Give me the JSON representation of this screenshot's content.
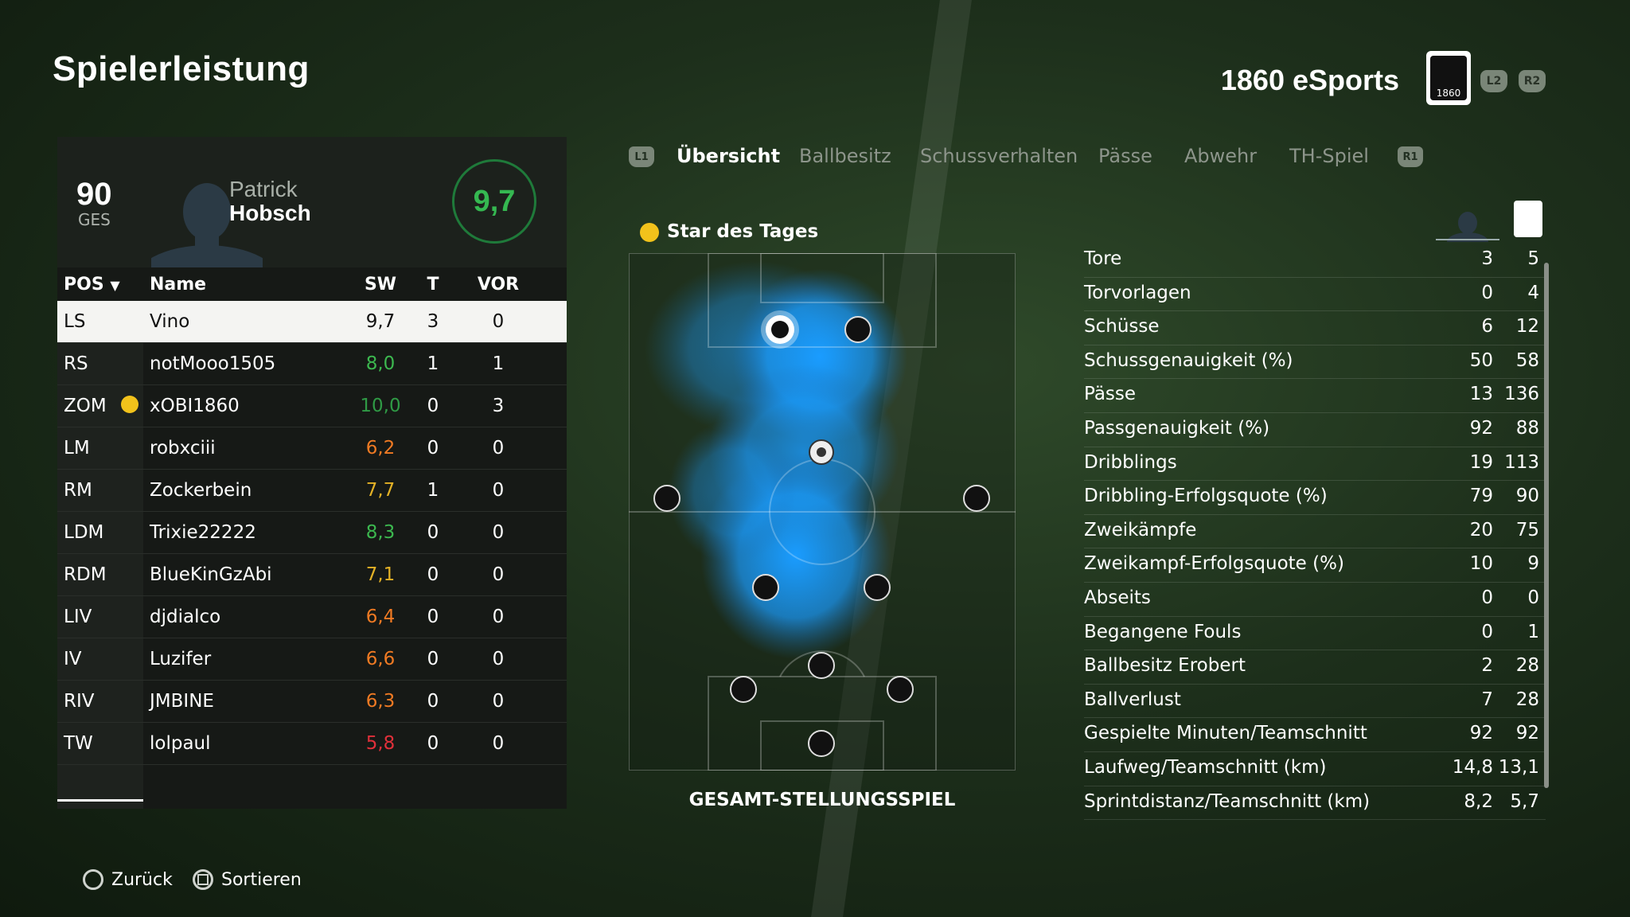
{
  "header": {
    "title": "Spielerleistung",
    "team_name": "1860 eSports",
    "crest_text": "1860",
    "l2": "L2",
    "r2": "R2"
  },
  "player_card": {
    "overall": "90",
    "overall_label": "GES",
    "first_name": "Patrick",
    "last_name": "Hobsch",
    "rating": "9,7"
  },
  "table": {
    "headers": {
      "pos": "POS",
      "name": "Name",
      "sw": "SW",
      "t": "T",
      "vor": "VOR"
    },
    "rows": [
      {
        "pos": "LS",
        "name": "Vino",
        "sw": "9,7",
        "t": "3",
        "vor": "0",
        "color": "#111111"
      },
      {
        "pos": "RS",
        "name": "notMooo1505",
        "sw": "8,0",
        "t": "1",
        "vor": "1",
        "color": "#3cb84f"
      },
      {
        "pos": "ZOM",
        "name": "xOBI1860",
        "sw": "10,0",
        "t": "0",
        "vor": "3",
        "color": "#2f9a45"
      },
      {
        "pos": "LM",
        "name": "robxciii",
        "sw": "6,2",
        "t": "0",
        "vor": "0",
        "color": "#f07a23"
      },
      {
        "pos": "RM",
        "name": "Zockerbein",
        "sw": "7,7",
        "t": "1",
        "vor": "0",
        "color": "#e3b126"
      },
      {
        "pos": "LDM",
        "name": "Trixie22222",
        "sw": "8,3",
        "t": "0",
        "vor": "0",
        "color": "#3cb84f"
      },
      {
        "pos": "RDM",
        "name": "BlueKinGzAbi",
        "sw": "7,1",
        "t": "0",
        "vor": "0",
        "color": "#e3b126"
      },
      {
        "pos": "LIV",
        "name": "djdialco",
        "sw": "6,4",
        "t": "0",
        "vor": "0",
        "color": "#f07a23"
      },
      {
        "pos": "IV",
        "name": "Luzifer",
        "sw": "6,6",
        "t": "0",
        "vor": "0",
        "color": "#f07a23"
      },
      {
        "pos": "RIV",
        "name": "JMBINE",
        "sw": "6,3",
        "t": "0",
        "vor": "0",
        "color": "#f07a23"
      },
      {
        "pos": "TW",
        "name": "lolpaul",
        "sw": "5,8",
        "t": "0",
        "vor": "0",
        "color": "#e0303a"
      }
    ]
  },
  "tabs": {
    "l1": "L1",
    "r1": "R1",
    "items": [
      "Übersicht",
      "Ballbesitz",
      "Schussverhalten",
      "Pässe",
      "Abwehr",
      "TH-Spiel"
    ],
    "active": "Übersicht"
  },
  "star_of_day": "Star des Tages",
  "pitch_caption": "GESAMT-STELLUNGSSPIEL",
  "stats": [
    {
      "label": "Tore",
      "player": "3",
      "team": "5"
    },
    {
      "label": "Torvorlagen",
      "player": "0",
      "team": "4"
    },
    {
      "label": "Schüsse",
      "player": "6",
      "team": "12"
    },
    {
      "label": "Schussgenauigkeit (%)",
      "player": "50",
      "team": "58"
    },
    {
      "label": "Pässe",
      "player": "13",
      "team": "136"
    },
    {
      "label": "Passgenauigkeit (%)",
      "player": "92",
      "team": "88"
    },
    {
      "label": "Dribblings",
      "player": "19",
      "team": "113"
    },
    {
      "label": "Dribbling-Erfolgsquote (%)",
      "player": "79",
      "team": "90"
    },
    {
      "label": "Zweikämpfe",
      "player": "20",
      "team": "75"
    },
    {
      "label": "Zweikampf-Erfolgsquote (%)",
      "player": "10",
      "team": "9"
    },
    {
      "label": "Abseits",
      "player": "0",
      "team": "0"
    },
    {
      "label": "Begangene Fouls",
      "player": "0",
      "team": "1"
    },
    {
      "label": "Ballbesitz Erobert",
      "player": "2",
      "team": "28"
    },
    {
      "label": "Ballverlust",
      "player": "7",
      "team": "28"
    },
    {
      "label": "Gespielte Minuten/Teamschnitt",
      "player": "92",
      "team": "92"
    },
    {
      "label": "Laufweg/Teamschnitt (km)",
      "player": "14,8",
      "team": "13,1"
    },
    {
      "label": "Sprintdistanz/Teamschnitt (km)",
      "player": "8,2",
      "team": "5,7"
    }
  ],
  "footer": {
    "back": "Zurück",
    "sort": "Sortieren"
  },
  "colors": {
    "heatmap": "#1a9cff",
    "rating_ring": "#1f7a3a",
    "star": "#f2c21b"
  }
}
